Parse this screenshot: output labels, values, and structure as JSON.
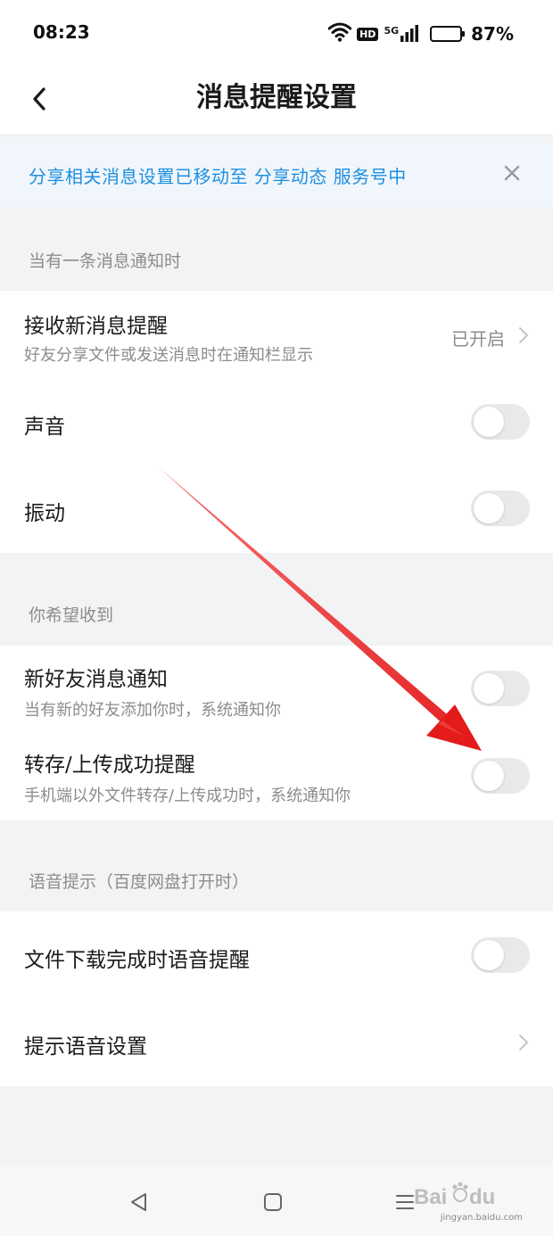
{
  "status_bar": {
    "time": "08:23",
    "network": "5G",
    "hd_badge": "HD",
    "battery_level": 0.87,
    "battery_percent": "87%",
    "icons": [
      "wifi-icon",
      "hd-icon",
      "signal-5g-icon",
      "battery-icon"
    ]
  },
  "header": {
    "title": "消息提醒设置",
    "back_icon": "back-arrow-icon"
  },
  "notice": {
    "text": "分享相关消息设置已移动至 分享动态 服务号中",
    "close_icon": "close-icon",
    "color": "#1e8fe0"
  },
  "sections": [
    {
      "header": "当有一条消息通知时",
      "rows": [
        {
          "title": "接收新消息提醒",
          "subtitle": "好友分享文件或发送消息时在通知栏显示",
          "value": "已开启",
          "control": "chevron"
        },
        {
          "title": "声音",
          "control": "toggle",
          "on": false
        },
        {
          "title": "振动",
          "control": "toggle",
          "on": false
        }
      ]
    },
    {
      "header": "你希望收到",
      "rows": [
        {
          "title": "新好友消息通知",
          "subtitle": "当有新的好友添加你时，系统通知你",
          "control": "toggle",
          "on": false
        },
        {
          "title": "转存/上传成功提醒",
          "subtitle": "手机端以外文件转存/上传成功时，系统通知你",
          "control": "toggle",
          "on": false
        }
      ]
    },
    {
      "header": "语音提示（百度网盘打开时）",
      "rows": [
        {
          "title": "文件下载完成时语音提醒",
          "control": "toggle",
          "on": false
        },
        {
          "title": "提示语音设置",
          "control": "chevron"
        }
      ]
    }
  ],
  "nav_bar": {
    "buttons": [
      "back-triangle-icon",
      "home-square-icon",
      "menu-lines-icon"
    ]
  },
  "watermark": {
    "brand": "Baidu 经验",
    "url": "jingyan.baidu.com"
  },
  "colors": {
    "accent": "#1e8fe0",
    "arrow": "#e8231f",
    "toggle_off": "#e9e9eb"
  }
}
